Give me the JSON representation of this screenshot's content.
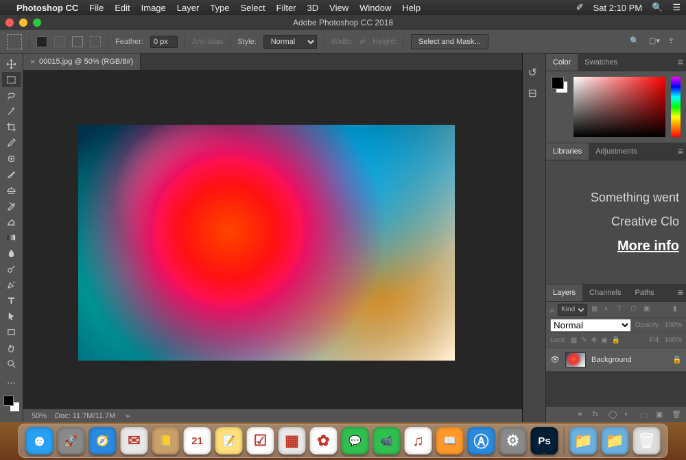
{
  "menubar": {
    "apple": "",
    "app": "Photoshop CC",
    "items": [
      "File",
      "Edit",
      "Image",
      "Layer",
      "Type",
      "Select",
      "Filter",
      "3D",
      "View",
      "Window",
      "Help"
    ],
    "clock": "Sat 2:10 PM"
  },
  "window": {
    "title": "Adobe Photoshop CC 2018"
  },
  "options": {
    "feather_label": "Feather:",
    "feather_value": "0 px",
    "anti_alias": "Anti-alias",
    "style_label": "Style:",
    "style_value": "Normal",
    "width_label": "Width:",
    "height_label": "Height:",
    "select_mask": "Select and Mask..."
  },
  "document": {
    "tab_label": "00015.jpg @ 50% (RGB/8#)",
    "zoom": "50%",
    "doc_size": "Doc: 11.7M/11.7M"
  },
  "panels": {
    "color_tab": "Color",
    "swatches_tab": "Swatches",
    "libraries_tab": "Libraries",
    "adjustments_tab": "Adjustments",
    "lib_error_line1": "Something went",
    "lib_error_line2": "Creative Clo",
    "lib_more_info": "More info",
    "layers_tab": "Layers",
    "channels_tab": "Channels",
    "paths_tab": "Paths",
    "kind_filter": "Kind",
    "blend_mode": "Normal",
    "opacity_label": "Opacity:",
    "opacity_value": "100%",
    "lock_label": "Lock:",
    "fill_label": "Fill:",
    "fill_value": "100%",
    "layer_name": "Background"
  },
  "tools": [
    "move-tool",
    "rectangular-marquee-tool",
    "lasso-tool",
    "magic-wand-tool",
    "crop-tool",
    "eyedropper-tool",
    "spot-healing-tool",
    "brush-tool",
    "clone-stamp-tool",
    "history-brush-tool",
    "eraser-tool",
    "gradient-tool",
    "blur-tool",
    "dodge-tool",
    "pen-tool",
    "type-tool",
    "path-selection-tool",
    "rectangle-tool",
    "hand-tool",
    "zoom-tool"
  ],
  "dock": {
    "apps": [
      {
        "name": "finder",
        "bg": "#2aa0f5",
        "glyph": "☻"
      },
      {
        "name": "launchpad",
        "bg": "#8a8a8a",
        "glyph": "🚀"
      },
      {
        "name": "safari",
        "bg": "#2a8ae0",
        "glyph": "🧭"
      },
      {
        "name": "mail",
        "bg": "#e8e8e8",
        "glyph": "✉"
      },
      {
        "name": "contacts",
        "bg": "#caa06a",
        "glyph": "📒"
      },
      {
        "name": "calendar",
        "bg": "#ffffff",
        "glyph": "21"
      },
      {
        "name": "notes",
        "bg": "#ffe07a",
        "glyph": "📝"
      },
      {
        "name": "reminders",
        "bg": "#ffffff",
        "glyph": "☑"
      },
      {
        "name": "spaces",
        "bg": "#e8e8e8",
        "glyph": "▦"
      },
      {
        "name": "photos",
        "bg": "#ffffff",
        "glyph": "✿"
      },
      {
        "name": "messages",
        "bg": "#30c050",
        "glyph": "💬"
      },
      {
        "name": "facetime",
        "bg": "#30c050",
        "glyph": "📹"
      },
      {
        "name": "itunes",
        "bg": "#ffffff",
        "glyph": "♫"
      },
      {
        "name": "ibooks",
        "bg": "#ff9a2a",
        "glyph": "📖"
      },
      {
        "name": "appstore",
        "bg": "#2a8ae0",
        "glyph": "Ⓐ"
      },
      {
        "name": "settings",
        "bg": "#8a8a8a",
        "glyph": "⚙"
      },
      {
        "name": "photoshop",
        "bg": "#001e36",
        "glyph": "Ps"
      }
    ],
    "right": [
      {
        "name": "downloads",
        "bg": "#6ab0e0",
        "glyph": "📁"
      },
      {
        "name": "documents",
        "bg": "#6ab0e0",
        "glyph": "📁"
      },
      {
        "name": "trash",
        "bg": "#dddddd",
        "glyph": "🗑"
      }
    ]
  },
  "calendar_day": "21"
}
